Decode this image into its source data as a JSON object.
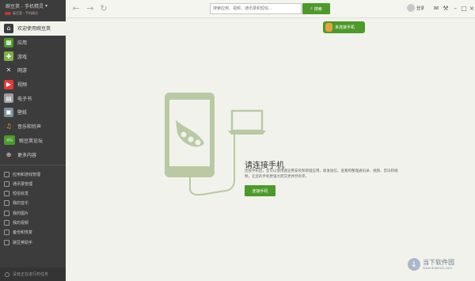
{
  "app": {
    "title": "豌豆荚 - 手机精灵",
    "subtitle": "豌豆荚 - 手机精灵"
  },
  "sidebar": {
    "items": [
      {
        "label": "欢迎使用豌豆荚",
        "icon": "home-icon",
        "color": "#f2f2ec",
        "active": true
      },
      {
        "label": "应用",
        "icon": "apps-icon",
        "color": "#4c9a2a"
      },
      {
        "label": "游戏",
        "icon": "gamepad-icon",
        "color": "#7cb342"
      },
      {
        "label": "网游",
        "icon": "sword-icon",
        "color": "#3c3c3c"
      },
      {
        "label": "视频",
        "icon": "video-icon",
        "color": "#e53935"
      },
      {
        "label": "电子书",
        "icon": "book-icon",
        "color": "#9e9e9e"
      },
      {
        "label": "壁纸",
        "icon": "wallpaper-icon",
        "color": "#78909c"
      },
      {
        "label": "音乐和铃声",
        "icon": "music-icon",
        "color": "#f9a825"
      },
      {
        "label": "豌豆荚论坛",
        "icon": "forum-icon",
        "color": "#4c9a2a",
        "badge": "论坛"
      },
      {
        "label": "更多内容",
        "icon": "more-icon",
        "color": "#555555"
      }
    ],
    "sub_items": [
      "应用和游戏管理",
      "通讯录管理",
      "短信收发",
      "我的音乐",
      "我的图片",
      "我的视频",
      "备份和恢复",
      "豌豆荚助手"
    ],
    "status": "没有正在进行的任务"
  },
  "topbar": {
    "search_placeholder": "搜索应用、视频、通讯录和短信...",
    "search_label": "搜索",
    "login_label": "登录"
  },
  "status": {
    "unconnected_label": "未连接手机"
  },
  "prompt": {
    "title": "请连接手机",
    "desc": "连接手机后，您可以使用豌豆荚安装和管理应用，收发短信，查看和整理通讯录、视频、音乐和视频，让您的手机更强大而又更井然有序。",
    "connect_label": "连接手机"
  },
  "watermark": {
    "text": "当下软件园",
    "url": "www.downxia.com"
  },
  "colors": {
    "accent": "#4c9a2a",
    "sidebar_bg": "#3c3c3c",
    "content_bg": "#f2f2ec",
    "illustration": "#b9c9a4"
  }
}
